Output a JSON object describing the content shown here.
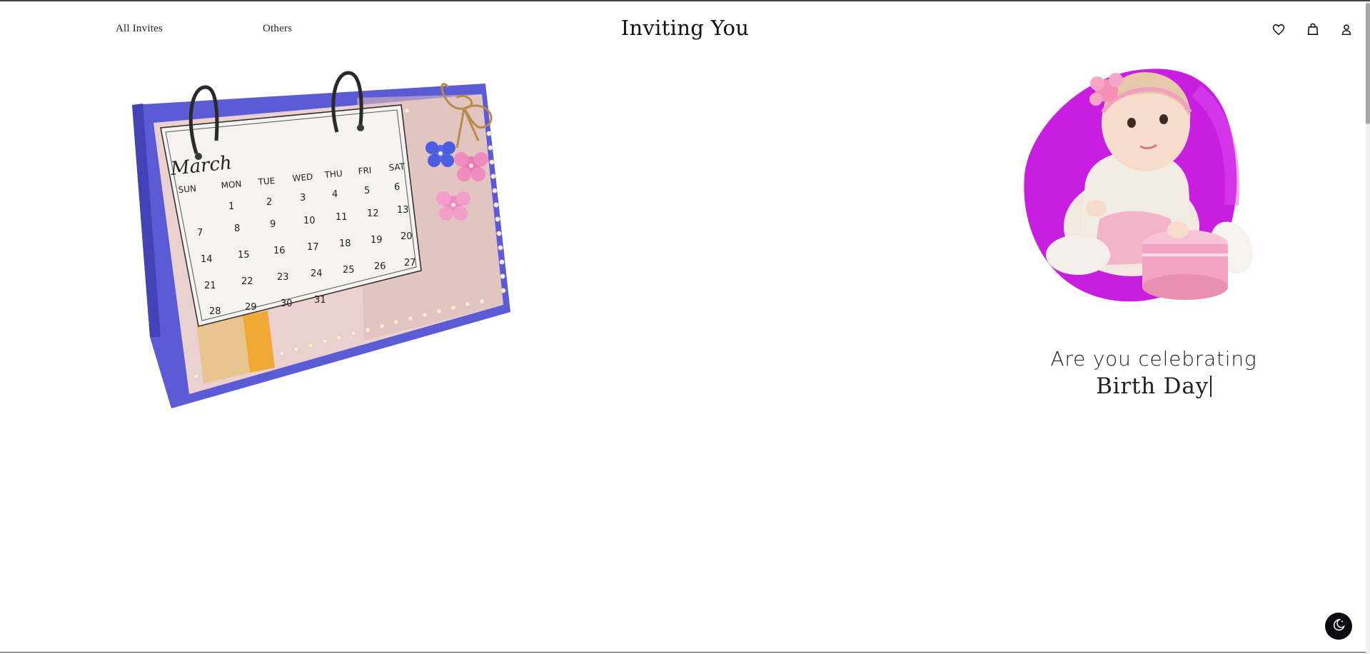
{
  "nav": {
    "all_invites": "All Invites",
    "others": "Others"
  },
  "brand": {
    "title": "Inviting You"
  },
  "header_icons": [
    "heart-icon",
    "shopping-bag-icon",
    "user-icon"
  ],
  "calendar_image": {
    "month": "March",
    "weekdays": [
      "SUN",
      "MON",
      "TUE",
      "WED",
      "THU",
      "FRI",
      "SAT"
    ],
    "days": [
      "1",
      "2",
      "3",
      "4",
      "5",
      "6",
      "7",
      "8",
      "9",
      "10",
      "11",
      "12",
      "13",
      "14",
      "15",
      "16",
      "17",
      "18",
      "19",
      "20",
      "21",
      "22",
      "23",
      "24",
      "25",
      "26",
      "27",
      "28",
      "29",
      "30",
      "31"
    ]
  },
  "hero": {
    "line1": "Are you celebrating",
    "line2": "Birth Day"
  },
  "theme_toggle": {
    "icon": "moon-icon"
  },
  "colors": {
    "calendar_base": "#5b5bd6",
    "calendar_board": "#e9c7c9",
    "blob": "#c81ee0",
    "toggle_bg": "#0b0b14"
  }
}
